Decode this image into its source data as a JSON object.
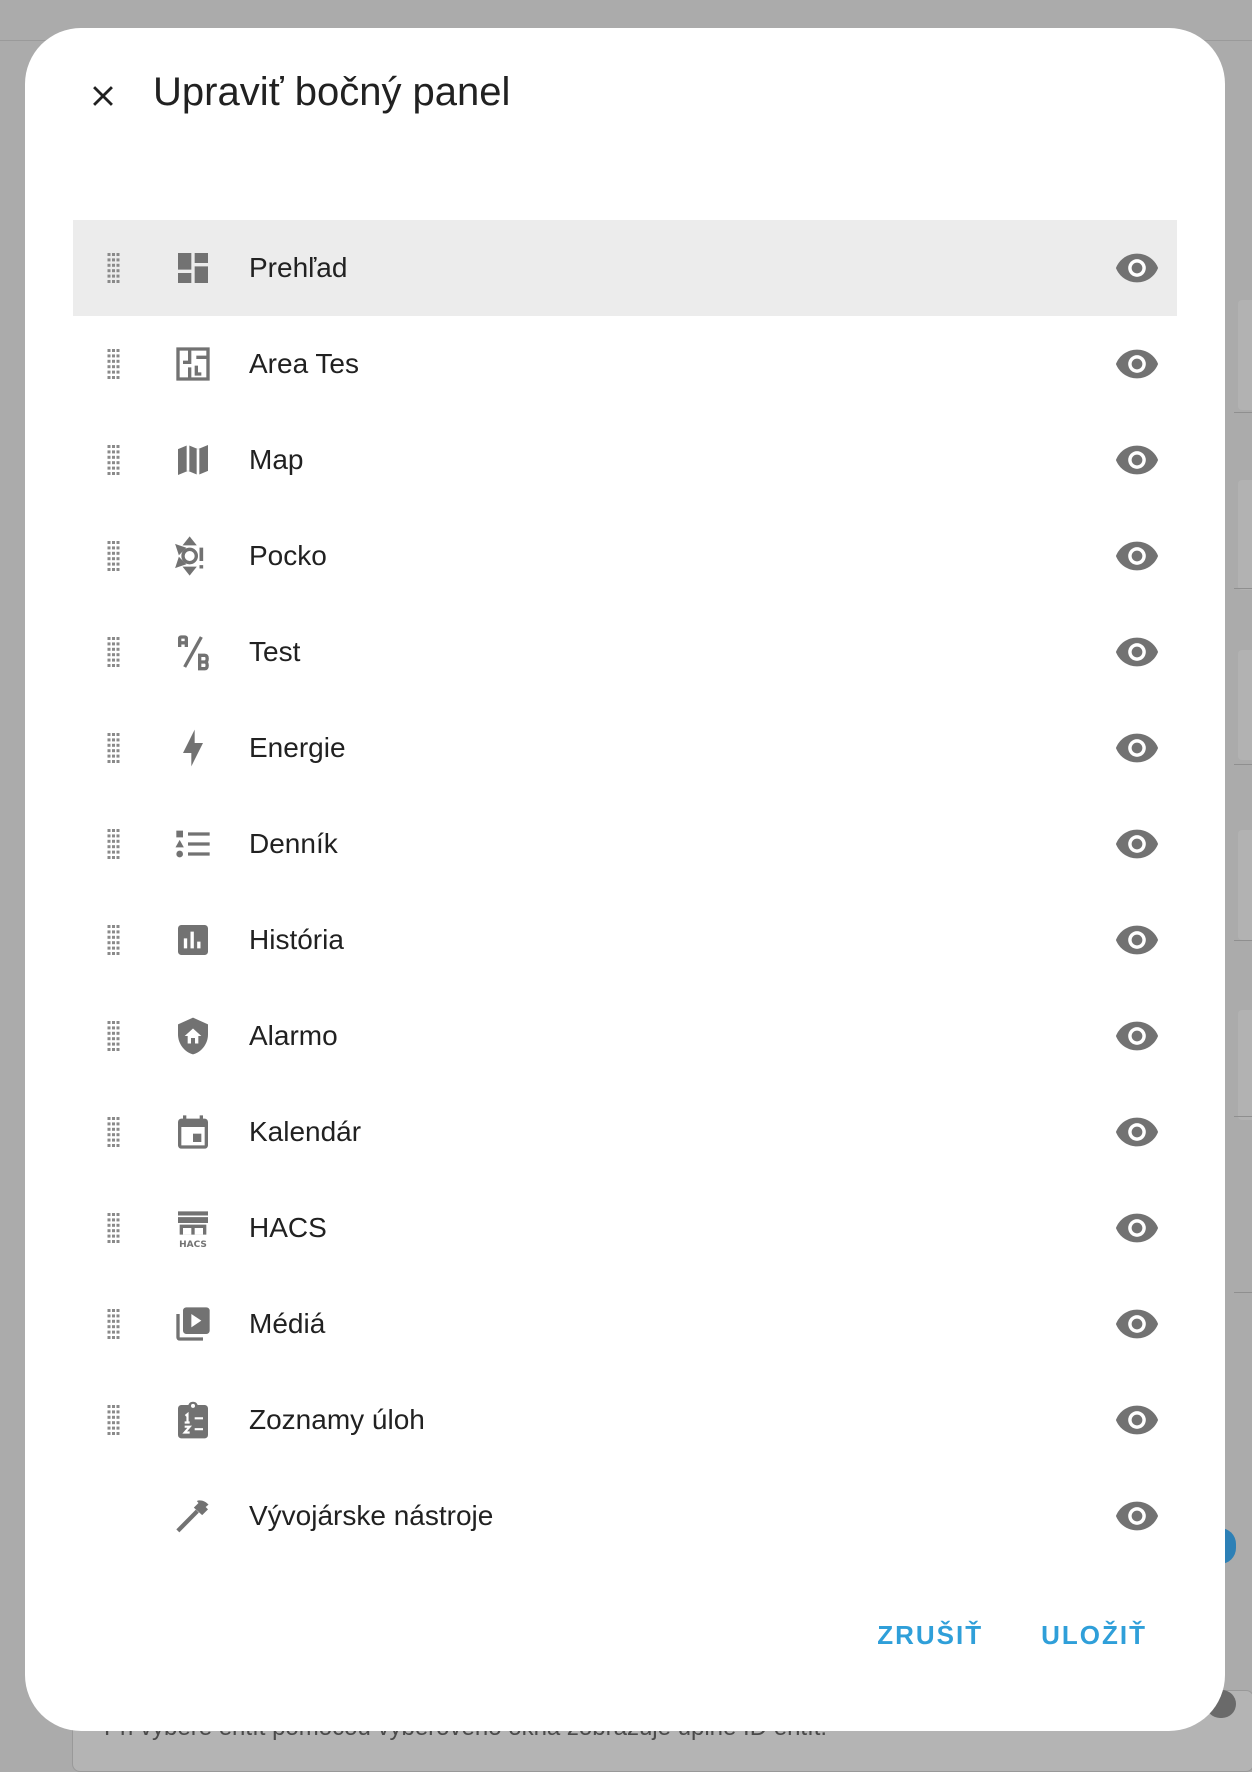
{
  "background": {
    "footer_text": "Pri výbere entít pomocou výberového okna zobrazuje úplné ID entít."
  },
  "dialog": {
    "title": "Upraviť bočný panel",
    "close_icon": "close-icon",
    "items": [
      {
        "label": "Prehľad",
        "icon": "view-dashboard-icon",
        "draggable": true,
        "visible": true,
        "selected": true
      },
      {
        "label": "Area Tes",
        "icon": "floor-plan-icon",
        "draggable": true,
        "visible": true
      },
      {
        "label": "Map",
        "icon": "map-icon",
        "draggable": true,
        "visible": true
      },
      {
        "label": "Pocko",
        "icon": "weather-alert-icon",
        "draggable": true,
        "visible": true
      },
      {
        "label": "Test",
        "icon": "ab-testing-icon",
        "draggable": true,
        "visible": true
      },
      {
        "label": "Energie",
        "icon": "lightning-bolt-icon",
        "draggable": true,
        "visible": true
      },
      {
        "label": "Denník",
        "icon": "format-list-bulleted-type-icon",
        "draggable": true,
        "visible": true
      },
      {
        "label": "História",
        "icon": "chart-box-icon",
        "draggable": true,
        "visible": true
      },
      {
        "label": "Alarmo",
        "icon": "shield-home-icon",
        "draggable": true,
        "visible": true
      },
      {
        "label": "Kalendár",
        "icon": "calendar-icon",
        "draggable": true,
        "visible": true
      },
      {
        "label": "HACS",
        "icon": "hacs-store-icon",
        "draggable": true,
        "visible": true
      },
      {
        "label": "Médiá",
        "icon": "play-box-multiple-icon",
        "draggable": true,
        "visible": true
      },
      {
        "label": "Zoznamy úloh",
        "icon": "clipboard-list-icon",
        "draggable": true,
        "visible": true
      },
      {
        "label": "Vývojárske nástroje",
        "icon": "hammer-icon",
        "draggable": false,
        "visible": true
      }
    ],
    "actions": {
      "cancel_label": "ZRUŠIŤ",
      "save_label": "ULOŽIŤ"
    }
  },
  "colors": {
    "icon": "#727272",
    "accent": "#2f9fd9",
    "selected_row": "#ececec",
    "scrim": "#ababab"
  }
}
